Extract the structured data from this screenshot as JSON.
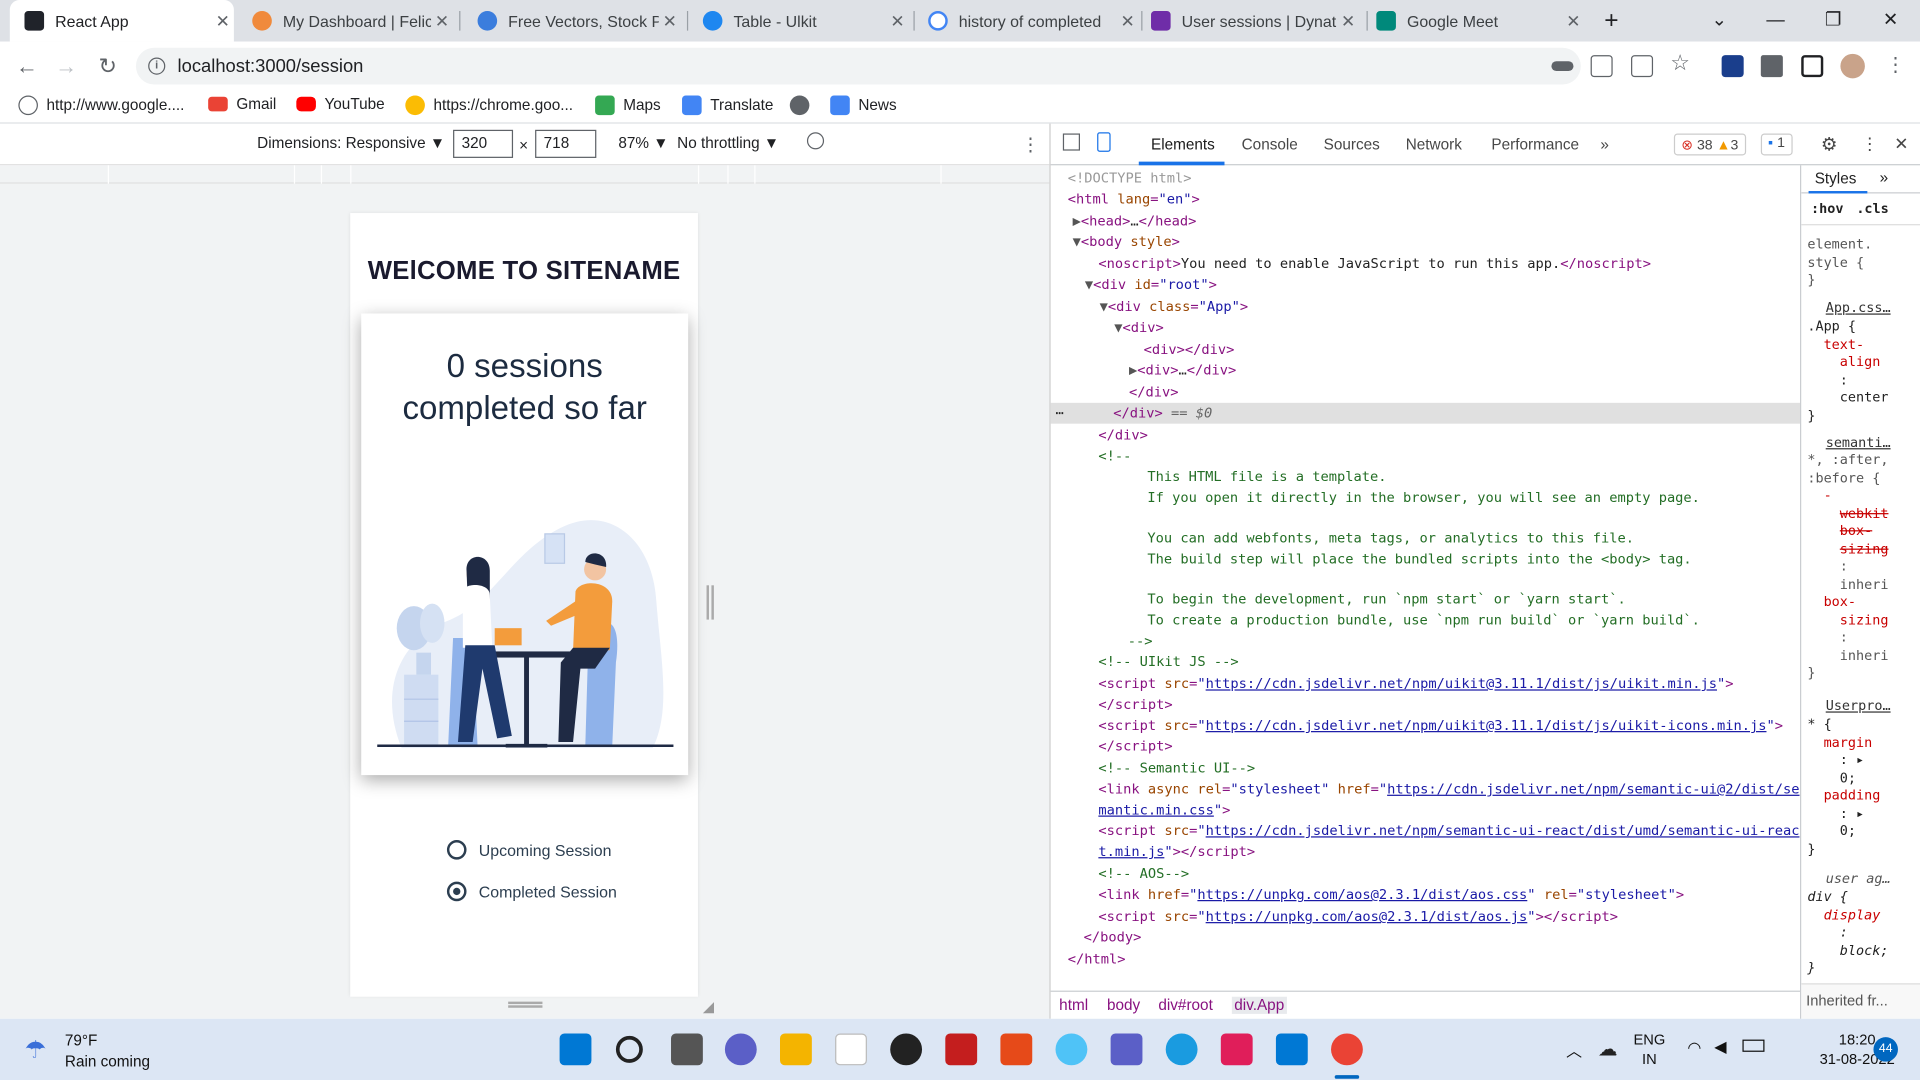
{
  "browser": {
    "tabs": [
      {
        "title": "React App",
        "color": "#20232a"
      },
      {
        "title": "My Dashboard | Felici",
        "color": "#f08a3c"
      },
      {
        "title": "Free Vectors, Stock Ph",
        "color": "#3b7ddd"
      },
      {
        "title": "Table - Ulkit",
        "color": "#1e87f0"
      },
      {
        "title": "history of completed",
        "color": "#4285f4"
      },
      {
        "title": "User sessions | Dynat",
        "color": "#6f2da8"
      },
      {
        "title": "Google Meet",
        "color": "#00897b"
      }
    ],
    "url": "localhost:3000/session",
    "bookmarks": [
      {
        "label": "http://www.google....",
        "color": "#5f6368"
      },
      {
        "label": "Gmail",
        "color": "#ea4335"
      },
      {
        "label": "YouTube",
        "color": "#ff0000"
      },
      {
        "label": "https://chrome.goo...",
        "color": "#fbbc04"
      },
      {
        "label": "Maps",
        "color": "#34a853"
      },
      {
        "label": "Translate",
        "color": "#4285f4"
      },
      {
        "label": "",
        "color": "#5f6368"
      },
      {
        "label": "News",
        "color": "#4285f4"
      }
    ]
  },
  "device_toolbar": {
    "dimensions_label": "Dimensions: Responsive ▼",
    "width": "320",
    "times": "×",
    "height": "718",
    "zoom": "87% ▼",
    "throttling": "No throttling ▼"
  },
  "page": {
    "site_title": "WElCOME TO SITENAME",
    "card_heading": "0 sessions completed so far",
    "radios": [
      {
        "label": "Upcoming Session",
        "checked": false
      },
      {
        "label": "Completed Session",
        "checked": true
      }
    ]
  },
  "devtools": {
    "tabs": [
      "Elements",
      "Console",
      "Sources",
      "Network",
      "Performance",
      "»"
    ],
    "errors": "38",
    "warnings": "3",
    "messages": "1",
    "styles_tab": "Styles",
    "hov": ":hov",
    "cls": ".cls",
    "breadcrumbs": [
      "html",
      "body",
      "div#root",
      "div.App"
    ],
    "inherited": "Inherited fr..."
  },
  "taskbar": {
    "temp": "79°F",
    "weather": "Rain coming",
    "lang1": "ENG",
    "lang2": "IN",
    "time": "18:20",
    "date": "31-08-2022",
    "notif": "44"
  }
}
